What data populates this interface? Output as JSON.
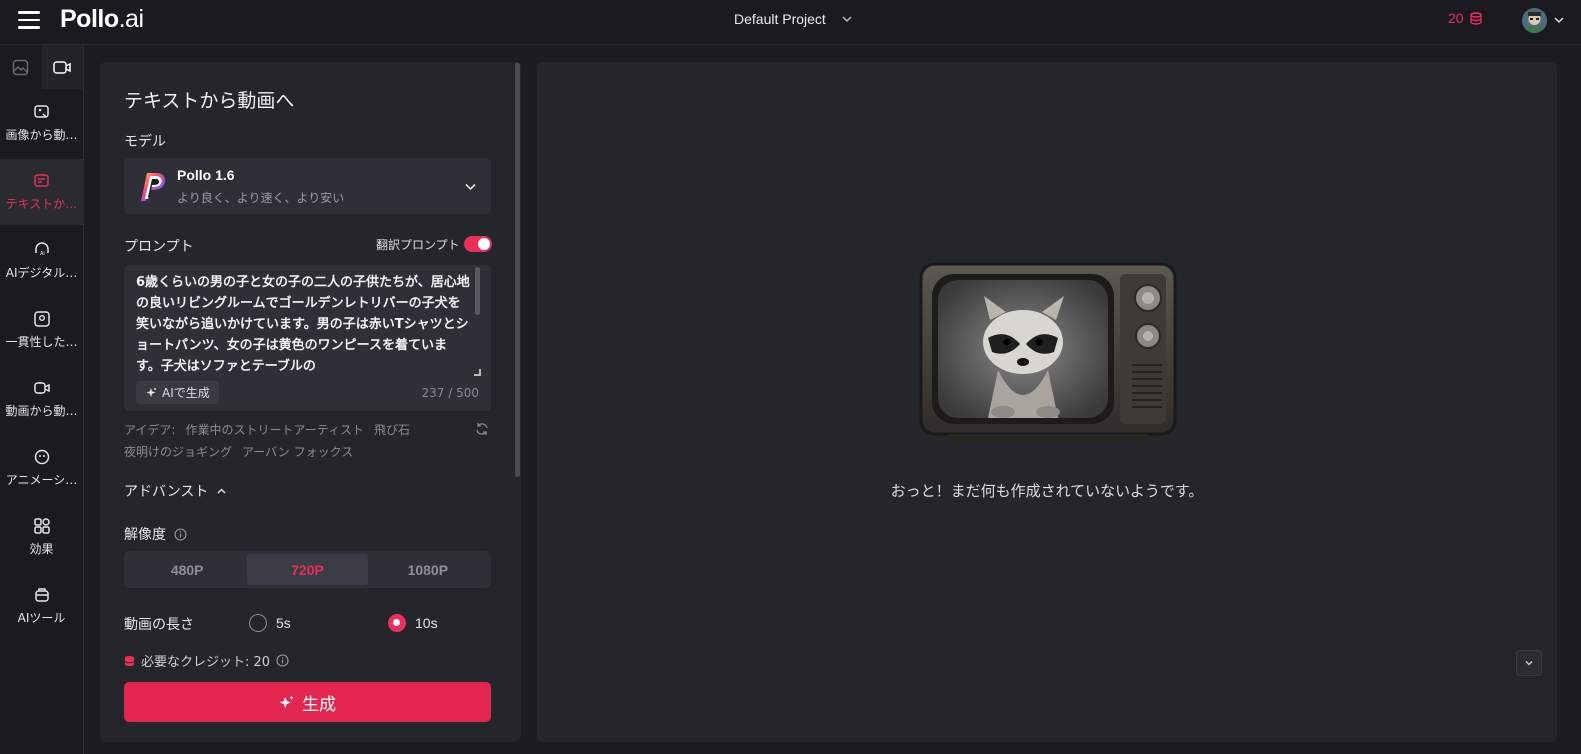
{
  "header": {
    "logo_main": "Pollo",
    "logo_suffix": ".ai",
    "project_name": "Default Project",
    "credits": "20"
  },
  "nav": {
    "items": [
      {
        "label": "画像から動…",
        "icon": "image-to-video-icon"
      },
      {
        "label": "テキストか…",
        "icon": "text-to-video-icon"
      },
      {
        "label": "AIデジタル…",
        "icon": "ai-avatar-icon"
      },
      {
        "label": "一貫性した…",
        "icon": "consistent-character-icon"
      },
      {
        "label": "動画から動…",
        "icon": "video-to-video-icon"
      },
      {
        "label": "アニメーシ…",
        "icon": "animation-icon"
      },
      {
        "label": "効果",
        "icon": "effects-icon"
      },
      {
        "label": "AIツール",
        "icon": "ai-tools-icon"
      }
    ]
  },
  "panel": {
    "title": "テキストから動画へ",
    "model_label": "モデル",
    "model_name": "Pollo 1.6",
    "model_desc": "より良く、より速く、より安い",
    "prompt_label": "プロンプト",
    "translate_label": "翻訳プロンプト",
    "translate_on": true,
    "prompt_text": "6歳くらいの男の子と女の子の二人の子供たちが、居心地の良いリビングルームでゴールデンレトリバーの子犬を笑いながら追いかけています。男の子は赤いTシャツとショートパンツ、女の子は黄色のワンピースを着ています。子犬はソファとテーブルの",
    "ai_generate": "AIで生成",
    "char_count": "237 / 500",
    "ideas_label": "アイデア:",
    "ideas": [
      "作業中のストリートアーティスト",
      "飛び石",
      "夜明けのジョギング",
      "アーバン フォックス"
    ],
    "advanced_label": "アドバンスト",
    "resolution_label": "解像度",
    "resolutions": [
      "480P",
      "720P",
      "1080P"
    ],
    "resolution_selected": "720P",
    "duration_label": "動画の長さ",
    "durations": [
      "5s",
      "10s"
    ],
    "duration_selected": "10s",
    "required_credits": "必要なクレジット: 20",
    "generate_label": "生成"
  },
  "canvas": {
    "empty_message": "おっと！まだ何も作成されていないようです。"
  },
  "colors": {
    "accent": "#e3264f",
    "background": "#1c1c22",
    "panel": "#25252c"
  }
}
